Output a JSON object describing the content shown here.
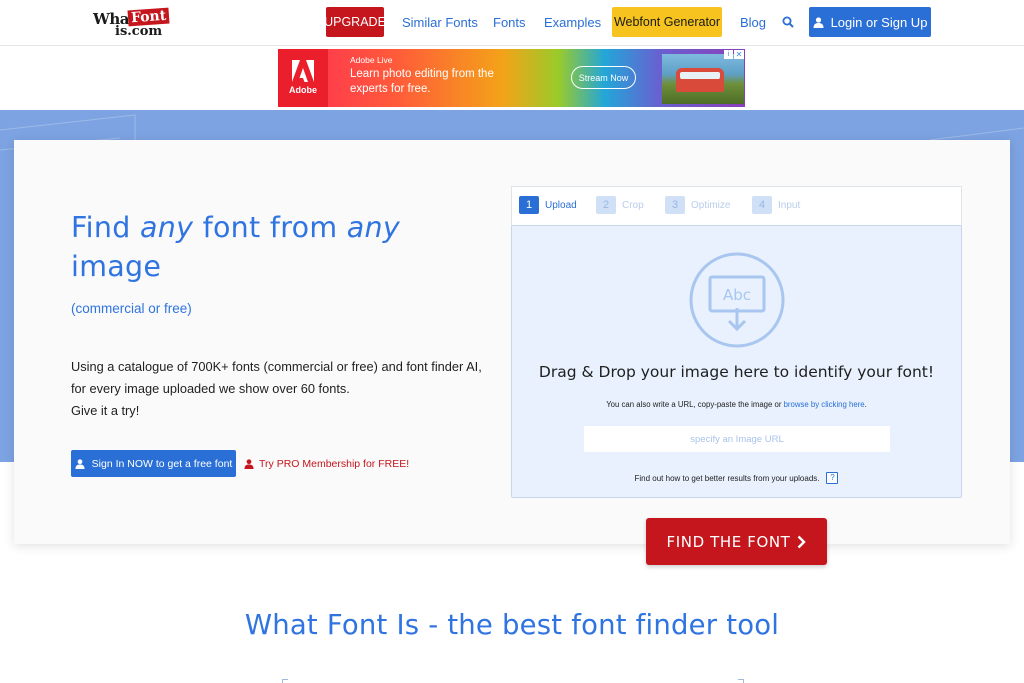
{
  "header": {
    "logo": {
      "line1": "What",
      "line2": "Font",
      "line3": "is.com"
    },
    "nav": {
      "upgrade": "UPGRADE",
      "similar_fonts": "Similar Fonts",
      "fonts": "Fonts",
      "examples": "Examples",
      "webfont_generator": "Webfont Generator",
      "blog": "Blog",
      "search_icon": "search-icon",
      "login": "Login or Sign Up"
    }
  },
  "ad": {
    "brand": "Adobe",
    "small_title": "Adobe Live",
    "headline": "Learn photo editing from the experts for free.",
    "cta": "Stream Now",
    "close": "✕",
    "info": "i"
  },
  "hero": {
    "headline_1": "Find ",
    "headline_any_1": "any",
    "headline_2": " font from ",
    "headline_any_2": "any",
    "headline_3": " image",
    "subhead": "(commercial or free)",
    "desc_1": "Using a catalogue of 700K+ fonts (commercial or free) and font finder AI,",
    "desc_2": "for every image uploaded we show over 60 fonts.",
    "desc_3": "Give it a try!",
    "signin_button": "Sign In NOW to get a free font",
    "pro_button": "Try PRO Membership for FREE!"
  },
  "upload": {
    "steps": [
      {
        "num": "1",
        "label": "Upload"
      },
      {
        "num": "2",
        "label": "Crop"
      },
      {
        "num": "3",
        "label": "Optimize"
      },
      {
        "num": "4",
        "label": "Input"
      }
    ],
    "icon_text": "Abc",
    "drop_title": "Drag & Drop your image here to identify your font!",
    "hint_prefix": "You can also write a URL, copy-paste the image or ",
    "hint_link": "browse by clicking here",
    "hint_suffix": ".",
    "url_placeholder": "specify an Image URL",
    "tips": "Find out how to get better results from your uploads.",
    "help": "?"
  },
  "find_button": "FIND THE FONT",
  "section_title": "What Font Is - the best font finder tool",
  "colors": {
    "brand_blue": "#2f74e0",
    "button_blue": "#2a6fd6",
    "brand_red": "#c4161c",
    "webfont_yellow": "#f7c41f",
    "hero_bg": "#7da3e2",
    "drop_bg": "#e8f1fd"
  }
}
